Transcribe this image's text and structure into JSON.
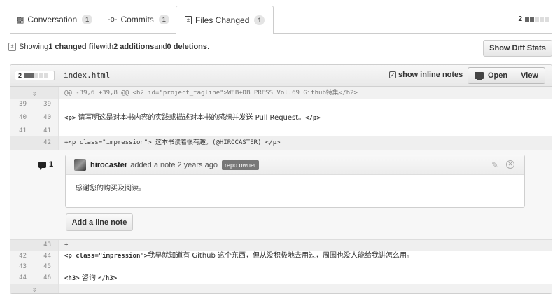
{
  "tabs": [
    {
      "label": "Conversation",
      "count": "1",
      "icon": "speech-bubbles-icon"
    },
    {
      "label": "Commits",
      "count": "1",
      "icon": "commit-icon"
    },
    {
      "label": "Files Changed",
      "count": "1",
      "icon": "file-diff-icon",
      "active": true
    }
  ],
  "tab_totals": {
    "count": "2"
  },
  "summary": {
    "prefix": "Showing ",
    "files": "1 changed file",
    "mid1": " with ",
    "additions": "2 additions",
    "mid2": " and ",
    "deletions": "0 deletions",
    "suffix": "."
  },
  "buttons": {
    "show_diff_stats": "Show Diff Stats"
  },
  "file": {
    "stat": "2",
    "name": "index.html",
    "show_inline_notes": "show inline notes",
    "open": "Open",
    "view": "View"
  },
  "diff": {
    "hunk_header": "@@ -39,6 +39,8 @@ <h2 id=\"project_tagline\">WEB+DB PRESS Vol.69 Github特集</h2>",
    "rows_top": [
      {
        "old": "39",
        "new": "39",
        "code": ""
      },
      {
        "old": "40",
        "new": "40",
        "code_tag": "<p>",
        "code_text": " 请写明这是对本书内容的实践或描述对本书的感想并发送 Pull Request。",
        "code_end": "</p>"
      },
      {
        "old": "41",
        "new": "41",
        "code": ""
      }
    ],
    "added_row": {
      "old": "",
      "new": "42",
      "code": "+<p class=\"impression\"> 这本书读着很有趣。(@HIROCASTER) </p>"
    },
    "rows_bottom": [
      {
        "old": "",
        "new": "43",
        "code": "+"
      },
      {
        "old": "42",
        "new": "44",
        "code_tag": "<p class=\"impression\">",
        "code_text": "我早就知道有 Github 这个东西，但从没积极地去用过，周围也没人能给我讲怎么用。",
        "code_end": ""
      },
      {
        "old": "43",
        "new": "45",
        "code": ""
      },
      {
        "old": "44",
        "new": "46",
        "code_tag": "<h3>",
        "code_text": " 咨询 ",
        "code_end": "</h3>"
      }
    ]
  },
  "comment": {
    "count": "1",
    "author": "hirocaster",
    "action": "added a note 2 years ago",
    "badge": "repo owner",
    "body": "感谢您的购买及阅读。",
    "add_line_note": "Add a line note"
  },
  "icons": {
    "expand": "expand-icon",
    "pencil": "pencil-icon",
    "close": "close-icon",
    "checkbox": "checkbox-checked-icon",
    "monitor": "monitor-icon"
  }
}
